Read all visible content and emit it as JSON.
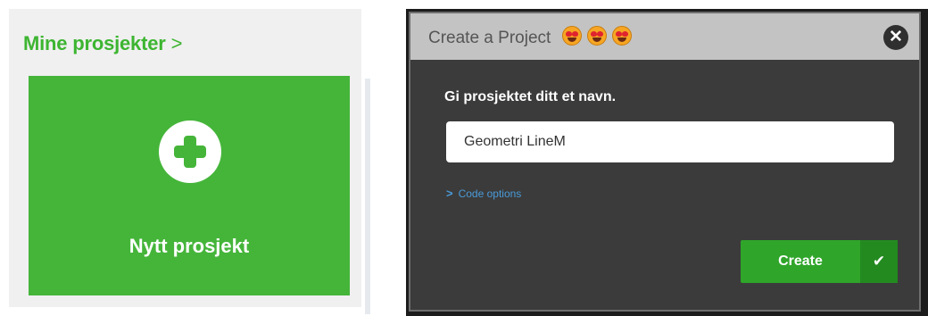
{
  "projects": {
    "heading": "Mine prosjekter",
    "heading_chevron": ">",
    "new_card_label": "Nytt prosjekt",
    "new_card_icon": "plus-icon"
  },
  "dialog": {
    "title": "Create a Project",
    "title_emojis": [
      "heart-eyes-emoji",
      "heart-eyes-emoji",
      "heart-eyes-emoji"
    ],
    "close_icon": "close-icon",
    "name_label": "Gi prosjektet ditt et navn.",
    "name_value": "Geometri LineM",
    "code_options_label": "Code options",
    "code_options_icon": "chevron-right-icon",
    "create_label": "Create",
    "create_icon": "checkmark-icon"
  },
  "colors": {
    "brand_green": "#45b53a",
    "dialog_bg": "#3b3b3b",
    "header_bg": "#c3c3c3",
    "link_blue": "#4a9ad8"
  }
}
